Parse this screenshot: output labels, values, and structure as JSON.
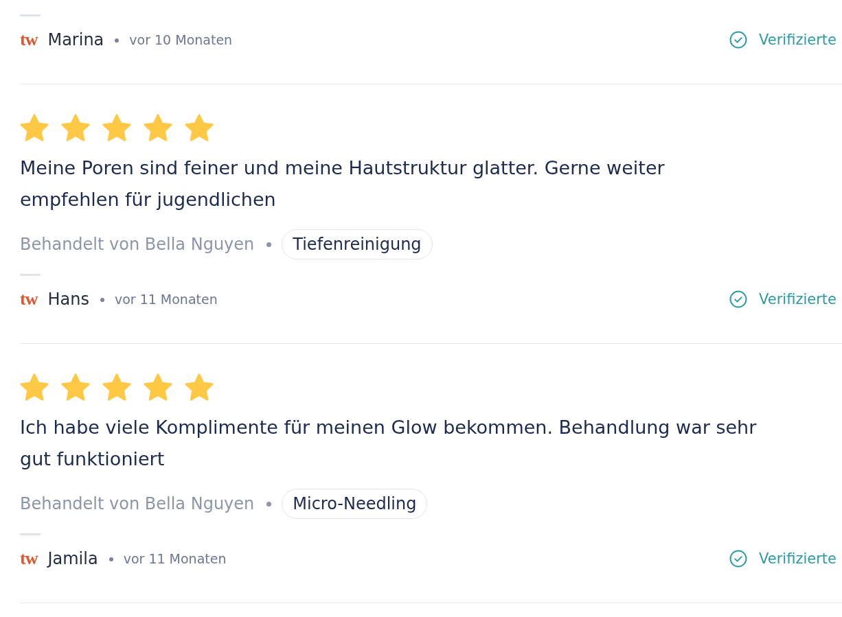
{
  "reviews": [
    {
      "source_logo": "tw",
      "author": "Marina",
      "time": "vor 10 Monaten",
      "verified_label": "Verifizierte"
    },
    {
      "stars": 5,
      "text": "Meine Poren sind feiner und meine Hautstruktur glatter. Gerne weiter empfehlen für jugendlichen",
      "treated_by": "Behandelt von Bella Nguyen",
      "treatment": "Tiefenreinigung",
      "source_logo": "tw",
      "author": "Hans",
      "time": "vor 11 Monaten",
      "verified_label": "Verifizierte"
    },
    {
      "stars": 5,
      "text": "Ich habe viele Komplimente für meinen Glow bekommen. Behandlung war sehr gut funktioniert",
      "treated_by": "Behandelt von Bella Nguyen",
      "treatment": "Micro-Needling",
      "source_logo": "tw",
      "author": "Jamila",
      "time": "vor 11 Monaten",
      "verified_label": "Verifizierte"
    }
  ]
}
